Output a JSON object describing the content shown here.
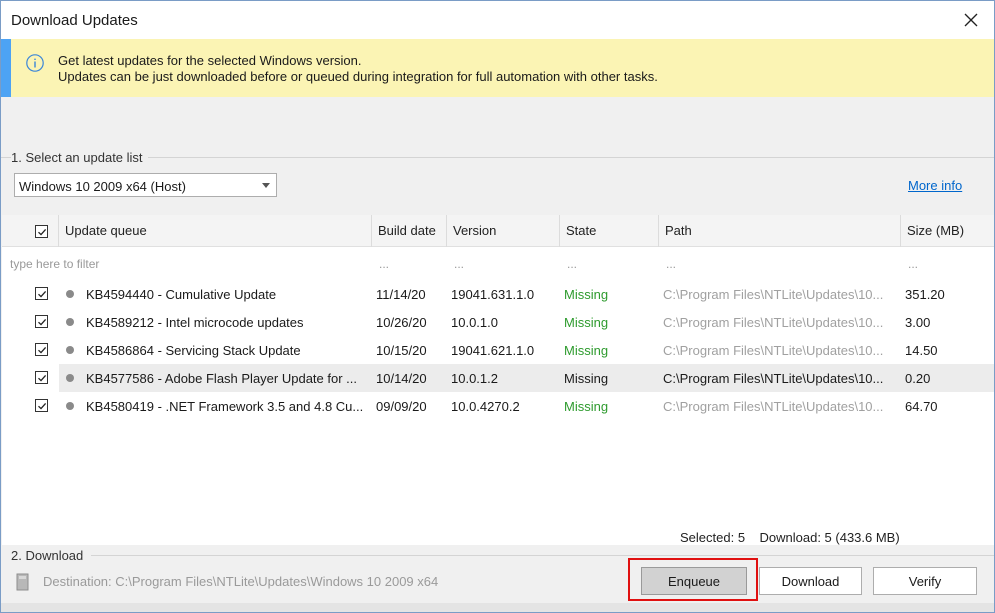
{
  "window": {
    "title": "Download Updates"
  },
  "info": {
    "line1": "Get latest updates for the selected Windows version.",
    "line2": "Updates can be just downloaded before or queued during integration for full automation with other tasks."
  },
  "section1": {
    "label": "1. Select an update list",
    "selected": "Windows 10 2009 x64 (Host)",
    "more_info": "More info"
  },
  "grid": {
    "headers": [
      "Update queue",
      "Build date",
      "Version",
      "State",
      "Path",
      "Size (MB)"
    ],
    "filter_placeholder": "type here to filter",
    "filter_dots": "...",
    "rows": [
      {
        "name": "KB4594440 - Cumulative Update",
        "date": "11/14/20",
        "version": "19041.631.1.0",
        "state": "Missing",
        "path": "C:\\Program Files\\NTLite\\Updates\\10...",
        "size": "351.20",
        "checked": true
      },
      {
        "name": "KB4589212 - Intel microcode updates",
        "date": "10/26/20",
        "version": "10.0.1.0",
        "state": "Missing",
        "path": "C:\\Program Files\\NTLite\\Updates\\10...",
        "size": "3.00",
        "checked": true
      },
      {
        "name": "KB4586864 - Servicing Stack Update",
        "date": "10/15/20",
        "version": "19041.621.1.0",
        "state": "Missing",
        "path": "C:\\Program Files\\NTLite\\Updates\\10...",
        "size": "14.50",
        "checked": true
      },
      {
        "name": "KB4577586 - Adobe Flash Player Update for ...",
        "date": "10/14/20",
        "version": "10.0.1.2",
        "state": "Missing",
        "path": "C:\\Program Files\\NTLite\\Updates\\10...",
        "size": "0.20",
        "checked": true,
        "selected": true
      },
      {
        "name": "KB4580419 - .NET Framework 3.5 and 4.8 Cu...",
        "date": "09/09/20",
        "version": "10.0.4270.2",
        "state": "Missing",
        "path": "C:\\Program Files\\NTLite\\Updates\\10...",
        "size": "64.70",
        "checked": true
      }
    ]
  },
  "status": {
    "selected": "Selected: 5",
    "download": "Download: 5 (433.6 MB)"
  },
  "section2": {
    "label": "2. Download",
    "destination": "Destination: C:\\Program Files\\NTLite\\Updates\\Windows 10 2009 x64"
  },
  "buttons": {
    "enqueue": "Enqueue",
    "download": "Download",
    "verify": "Verify"
  },
  "colors": {
    "info_bg": "#fbf4b4",
    "info_stripe": "#4da3f4",
    "missing": "#2e9b2e",
    "link": "#0066cc",
    "highlight": "#e01010"
  }
}
